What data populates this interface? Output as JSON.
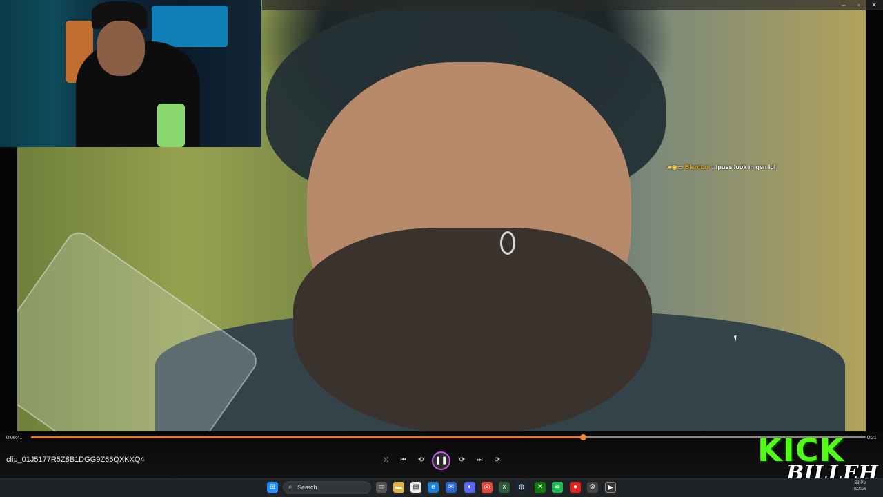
{
  "window": {
    "controls": [
      "–",
      "▫",
      "✕"
    ]
  },
  "chat": {
    "badges": "▰◉▭",
    "username": "BlerdLol",
    "separator": ":",
    "message": "!puss look in gen lol"
  },
  "player": {
    "current_time": "0:00:41",
    "duration": "0:21",
    "progress_fraction": 0.661,
    "clip_title": "clip_01J5177R5Z8B1DGG9Z66QXKXQ4",
    "buttons": {
      "shuffle": "⤨",
      "previous": "⏮",
      "rewind": "⟲",
      "play_pause": "❚❚",
      "forward": "⟳",
      "next": "⏭",
      "repeat": "⟳"
    },
    "accent_color": "#e8762a",
    "play_ring_color": "#c35be0"
  },
  "overlay": {
    "brand": "KICK",
    "signature": "BILLEH",
    "brand_color": "#53fc18"
  },
  "taskbar": {
    "search_placeholder": "Search",
    "tray_time": "53 PM",
    "tray_date": "8/2026"
  }
}
